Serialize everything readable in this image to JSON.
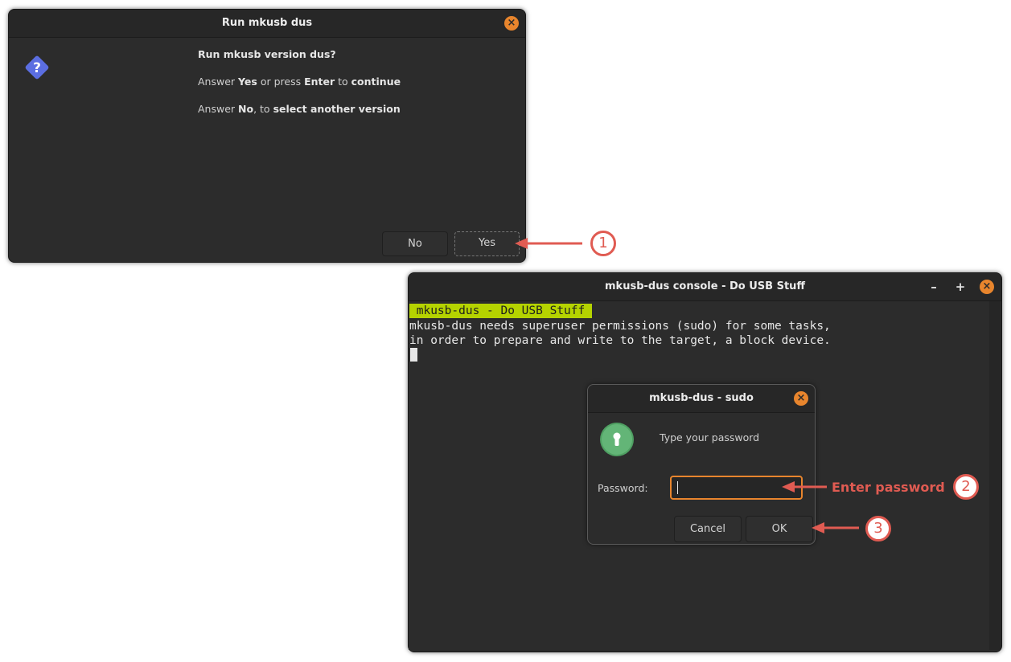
{
  "dialog1": {
    "title": "Run mkusb dus",
    "question": "Run mkusb version dus?",
    "line2": {
      "a": "Answer ",
      "yes": "Yes",
      "b": " or press ",
      "enter": "Enter",
      "c": " to ",
      "cont": "continue"
    },
    "line3": {
      "a": "Answer ",
      "no": "No",
      "b": ", to ",
      "sel": "select another version"
    },
    "no_label": "No",
    "yes_label": "Yes",
    "icon": "question-icon",
    "close_glyph": "×"
  },
  "console": {
    "title": "mkusb-dus console - Do USB Stuff",
    "minimize_glyph": "–",
    "maximize_glyph": "+",
    "close_glyph": "×",
    "lines": [
      " mkusb-dus - Do USB Stuff ",
      "mkusb-dus needs superuser permissions (sudo) for some tasks,",
      "in order to prepare and write to the target, a block device."
    ],
    "highlight_color": "#b5d300"
  },
  "sudo": {
    "title": "mkusb-dus - sudo",
    "prompt": "Type your password",
    "password_label": "Password:",
    "password_value": "",
    "cancel_label": "Cancel",
    "ok_label": "OK",
    "icon": "keyhole-icon",
    "close_glyph": "×"
  },
  "annotations": {
    "step1": "1",
    "step2": "2",
    "step3": "3",
    "enter_password": "Enter password",
    "color": "#e05b52"
  }
}
